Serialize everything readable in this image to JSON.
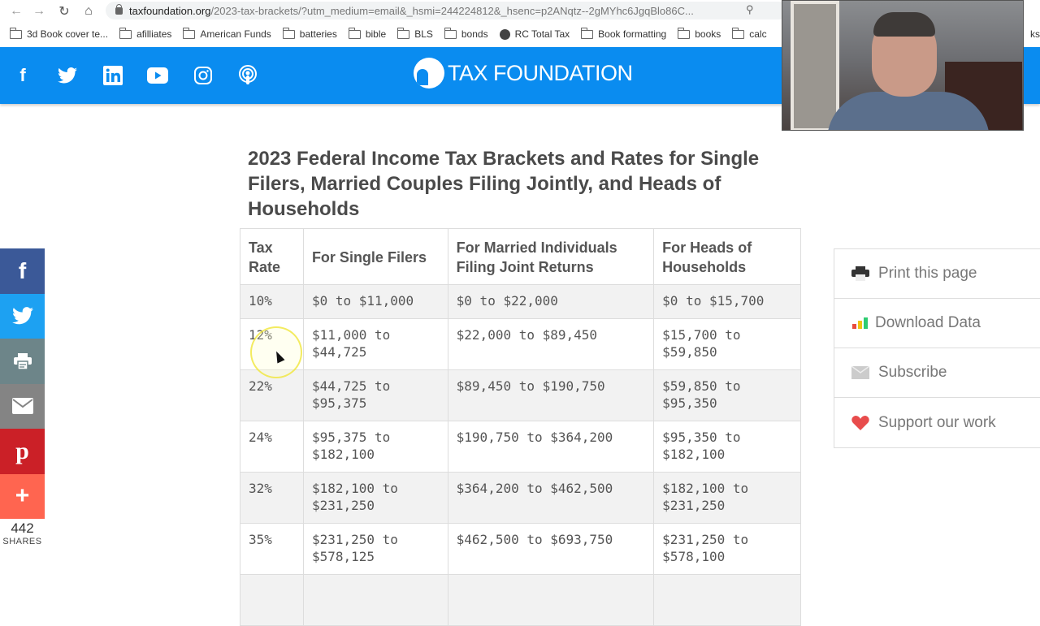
{
  "browser": {
    "url_domain": "taxfoundation.org",
    "url_path": "/2023-tax-brackets/?utm_medium=email&_hsmi=244224812&_hsenc=p2ANqtz--2gMYhc6JgqBlo86C...",
    "back_icon": "arrow-left-icon",
    "forward_icon": "arrow-right-icon",
    "reload_icon": "reload-icon",
    "home_icon": "home-icon",
    "bookmarks": [
      {
        "label": "3d Book cover te...",
        "icon": "folder-icon"
      },
      {
        "label": "afilliates",
        "icon": "folder-icon"
      },
      {
        "label": "American Funds",
        "icon": "folder-icon"
      },
      {
        "label": "batteries",
        "icon": "folder-icon"
      },
      {
        "label": "bible",
        "icon": "folder-icon"
      },
      {
        "label": "BLS",
        "icon": "folder-icon"
      },
      {
        "label": "bonds",
        "icon": "folder-icon"
      },
      {
        "label": "RC Total Tax",
        "icon": "globe-icon"
      },
      {
        "label": "Book formatting",
        "icon": "folder-icon"
      },
      {
        "label": "books",
        "icon": "folder-icon"
      },
      {
        "label": "calc",
        "icon": "folder-icon"
      }
    ],
    "bookmarks_overflow": "ks"
  },
  "header": {
    "brand": "TAX FOUNDATION",
    "social": [
      "facebook",
      "twitter",
      "linkedin",
      "youtube",
      "instagram",
      "podcast"
    ],
    "color": "#0a8cf0"
  },
  "article": {
    "heading": "2023 Federal Income Tax Brackets and Rates for Single Filers, Married Couples Filing Jointly, and Heads of Households",
    "table": {
      "headers": [
        "Tax Rate",
        "For Single Filers",
        "For Married Individuals Filing Joint Returns",
        "For Heads of Households"
      ],
      "rows": [
        [
          "10%",
          "$0 to $11,000",
          "$0 to $22,000",
          "$0 to $15,700"
        ],
        [
          "12%",
          "$11,000 to $44,725",
          "$22,000 to $89,450",
          "$15,700 to $59,850"
        ],
        [
          "22%",
          "$44,725 to $95,375",
          "$89,450 to $190,750",
          "$59,850 to $95,350"
        ],
        [
          "24%",
          "$95,375 to $182,100",
          "$190,750 to $364,200",
          "$95,350 to $182,100"
        ],
        [
          "32%",
          "$182,100 to $231,250",
          "$364,200 to $462,500",
          "$182,100 to $231,250"
        ],
        [
          "35%",
          "$231,250 to $578,125",
          "$462,500 to $693,750",
          "$231,250 to $578,100"
        ]
      ]
    }
  },
  "share_bar": {
    "buttons": [
      {
        "name": "facebook",
        "color": "#3b5998"
      },
      {
        "name": "twitter",
        "color": "#1da1f2"
      },
      {
        "name": "print",
        "color": "#6d8589"
      },
      {
        "name": "email",
        "color": "#848484"
      },
      {
        "name": "pinterest",
        "color": "#cb2027"
      },
      {
        "name": "more",
        "color": "#ff6550"
      }
    ],
    "count": "442",
    "label": "SHARES"
  },
  "actions": [
    {
      "label": "Print this page",
      "icon": "printer-icon"
    },
    {
      "label": "Download Data",
      "icon": "bar-chart-icon"
    },
    {
      "label": "Subscribe",
      "icon": "envelope-icon"
    },
    {
      "label": "Support our work",
      "icon": "heart-icon"
    }
  ]
}
